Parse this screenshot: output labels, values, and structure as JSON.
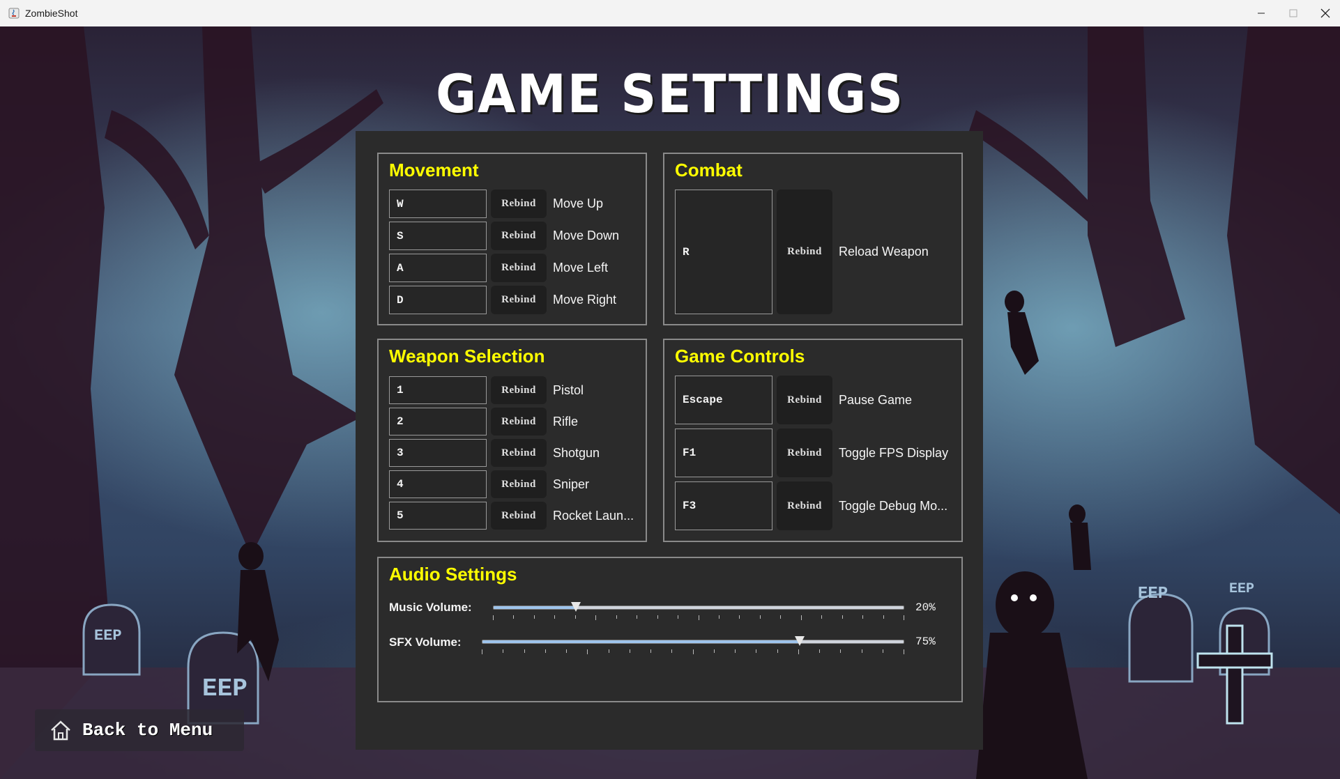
{
  "window": {
    "title": "ZombieShot"
  },
  "screen_title": "GAME SETTINGS",
  "groups": {
    "movement": {
      "title": "Movement",
      "bindings": [
        {
          "key": "W",
          "button": "Rebind",
          "action": "Move Up"
        },
        {
          "key": "S",
          "button": "Rebind",
          "action": "Move Down"
        },
        {
          "key": "A",
          "button": "Rebind",
          "action": "Move Left"
        },
        {
          "key": "D",
          "button": "Rebind",
          "action": "Move Right"
        }
      ]
    },
    "combat": {
      "title": "Combat",
      "bindings": [
        {
          "key": "R",
          "button": "Rebind",
          "action": "Reload Weapon"
        }
      ]
    },
    "weapon_selection": {
      "title": "Weapon Selection",
      "bindings": [
        {
          "key": "1",
          "button": "Rebind",
          "action": "Pistol"
        },
        {
          "key": "2",
          "button": "Rebind",
          "action": "Rifle"
        },
        {
          "key": "3",
          "button": "Rebind",
          "action": "Shotgun"
        },
        {
          "key": "4",
          "button": "Rebind",
          "action": "Sniper"
        },
        {
          "key": "5",
          "button": "Rebind",
          "action": "Rocket Laun..."
        }
      ]
    },
    "game_controls": {
      "title": "Game Controls",
      "bindings": [
        {
          "key": "Escape",
          "button": "Rebind",
          "action": "Pause Game"
        },
        {
          "key": "F1",
          "button": "Rebind",
          "action": "Toggle FPS Display"
        },
        {
          "key": "F3",
          "button": "Rebind",
          "action": "Toggle Debug Mo..."
        }
      ]
    }
  },
  "audio": {
    "title": "Audio Settings",
    "music": {
      "label": "Music Volume:",
      "value": 20,
      "display": "20%"
    },
    "sfx": {
      "label": "SFX Volume:",
      "value": 75,
      "display": "75%"
    }
  },
  "back_button": {
    "label": "Back to Menu",
    "icon": "home-icon"
  },
  "colors": {
    "section_title": "#ffff00",
    "panel": "#2b2b2b",
    "slider_fill": "#9ec4ec"
  }
}
